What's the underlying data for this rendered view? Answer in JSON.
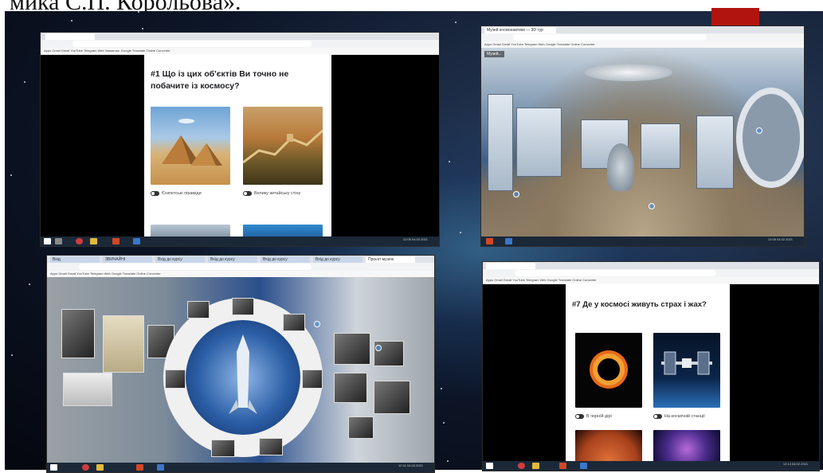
{
  "caption": "мика С.П. Корольова».",
  "top_left": {
    "bookmarks": "Apps  Gmail  Gmail  YouTube  Telegram Web  Завантаж.  Google Translate  Online Converter",
    "question": "#1 Що із цих об'єктів Ви точно не побачите із космосу?",
    "options": [
      "Єгипетські піраміди",
      "Велику китайську стіну"
    ],
    "time": "12:05\n04.02.2021"
  },
  "top_right": {
    "tab": "Музей космонавтики — 3D тур",
    "bookmarks": "Apps  Gmail  Gmail  YouTube  Telegram Web  Google Translate  Online Converter",
    "overlay_label": "Музей...",
    "time": "12:08\n04.02.2021"
  },
  "bottom_left": {
    "tabs": [
      "Вхід",
      "ЗВИЧАЙНІ",
      "Вхід до курсу",
      "Вхід до курсу",
      "Вхід до курсу",
      "Вхід до курсу",
      "Проєкт музею"
    ],
    "bookmarks": "Apps  Gmail  Gmail  YouTube  Telegram Web  Google Translate  Online Converter",
    "time": "12:11\n04.02.2021"
  },
  "bottom_right": {
    "bookmarks": "Apps  Gmail  Gmail  YouTube  Telegram Web  Google Translate  Online Converter",
    "question": "#7 Де у космосі живуть страх і жах?",
    "options": [
      "В чорній дірі",
      "На космічній станції"
    ],
    "time": "12:14\n04.02.2021"
  },
  "colors": {
    "red_block": "#b1140f",
    "taskbar": "#1b2838"
  }
}
